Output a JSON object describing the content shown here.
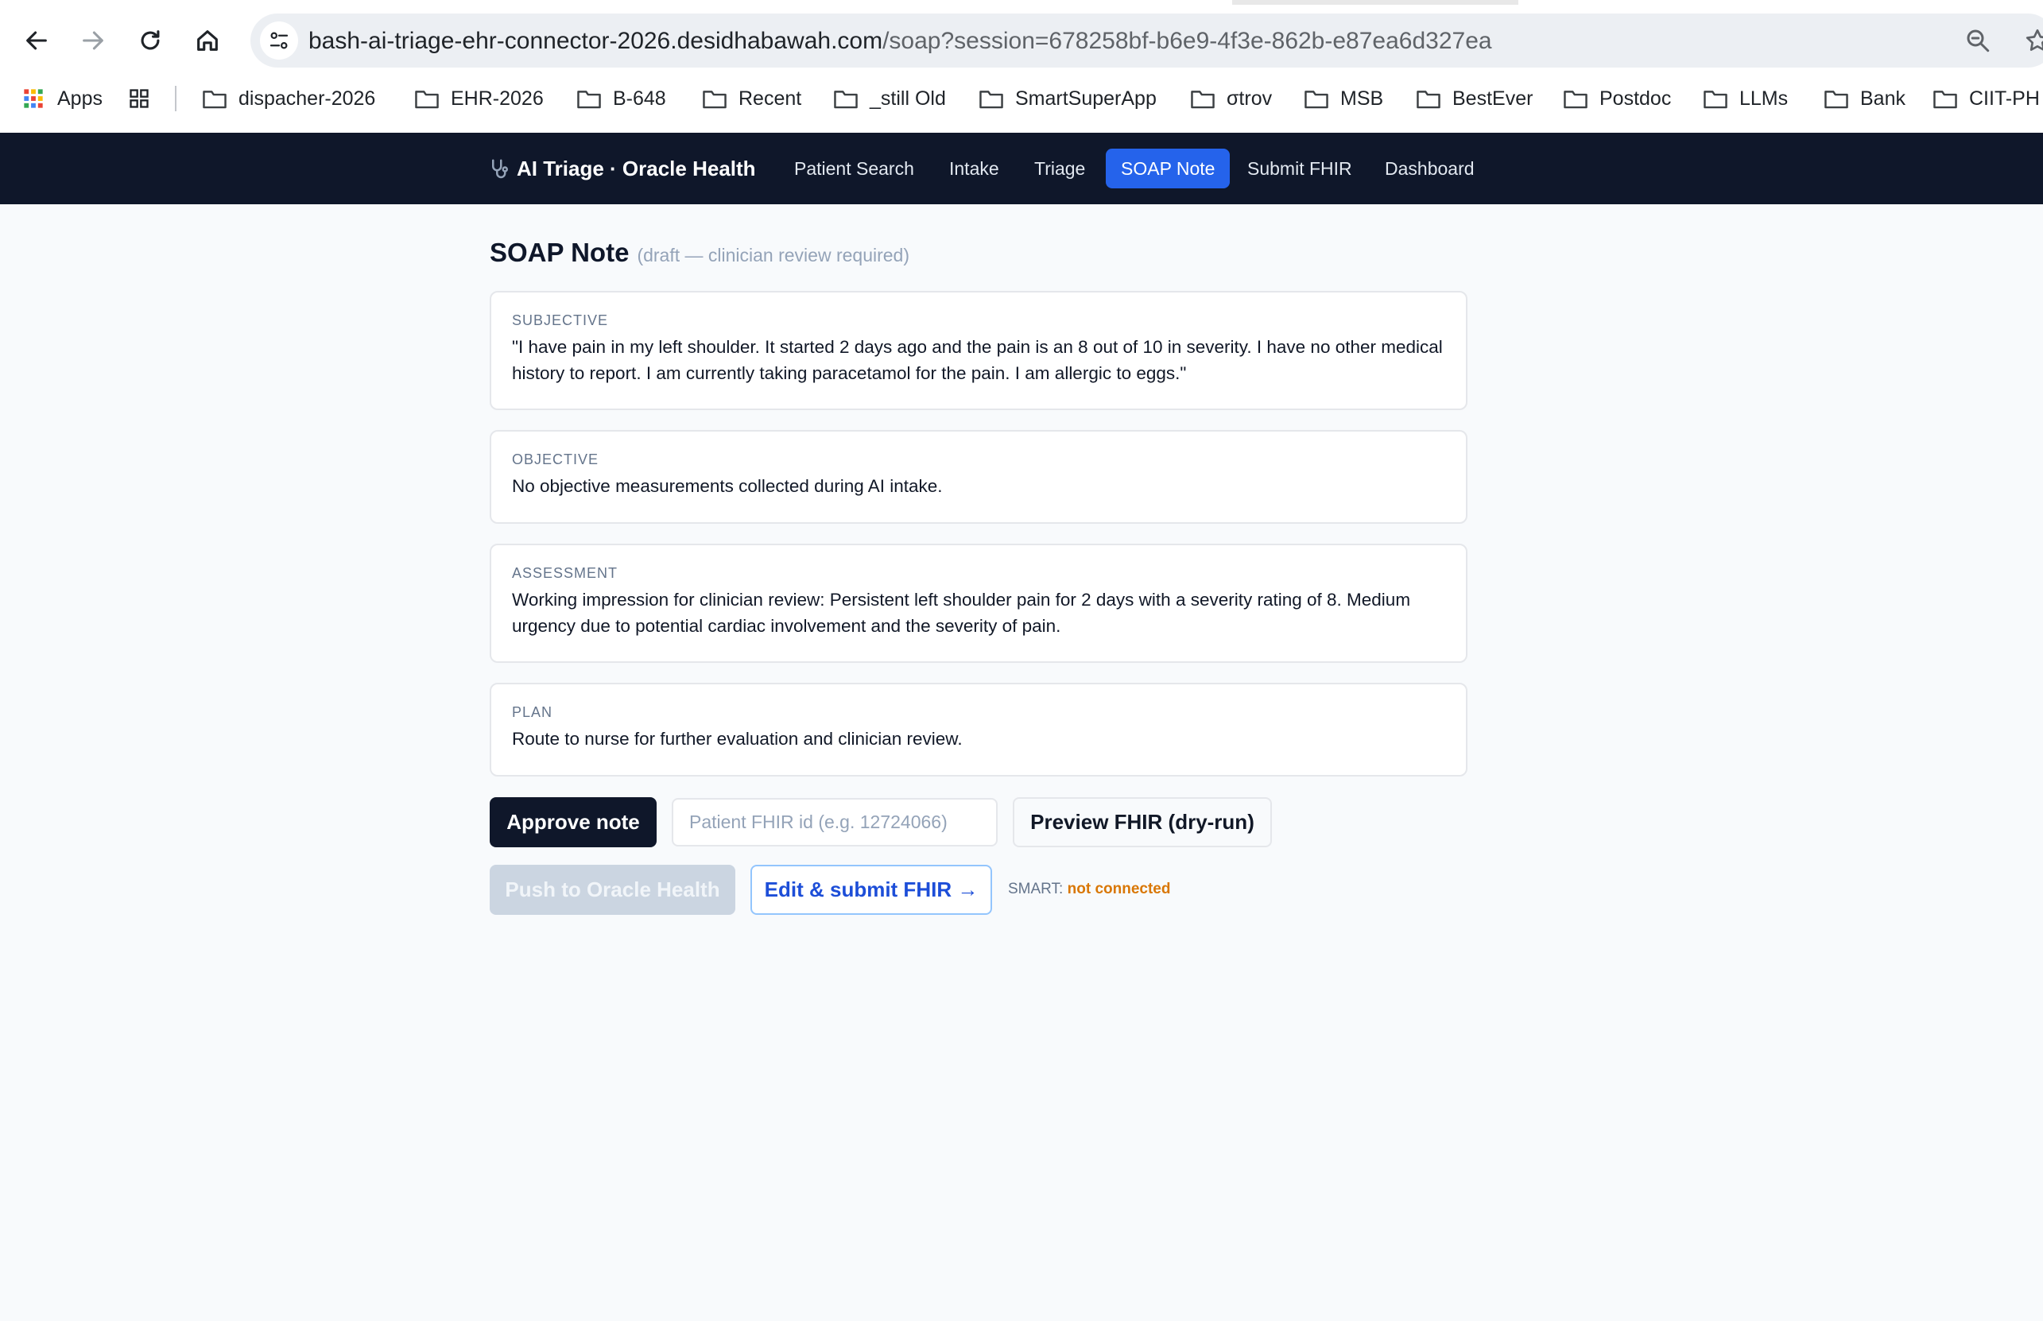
{
  "browser": {
    "url_host": "bash-ai-triage-ehr-connector-2026.desidhabawah.com",
    "url_path": "/soap?session=678258bf-b6e9-4f3e-862b-e87ea6d327ea",
    "bookmarks": [
      "Apps",
      "dispacher-2026",
      "EHR-2026",
      "B-648",
      "Recent",
      "_still Old",
      "SmartSuperApp",
      "σtrov",
      "MSB",
      "BestEver",
      "Postdoc",
      "LLMs",
      "Bank",
      "CIIT-PH"
    ]
  },
  "appnav": {
    "brand": "AI Triage · Oracle Health",
    "links": [
      "Patient Search",
      "Intake",
      "Triage",
      "SOAP Note",
      "Submit FHIR",
      "Dashboard"
    ],
    "active": "SOAP Note"
  },
  "page": {
    "title": "SOAP Note",
    "subtitle": "(draft — clinician review required)"
  },
  "soap": {
    "subjective": {
      "label": "Subjective",
      "text": "\"I have pain in my left shoulder. It started 2 days ago and the pain is an 8 out of 10 in severity. I have no other medical history to report. I am currently taking paracetamol for the pain. I am allergic to eggs.\""
    },
    "objective": {
      "label": "Objective",
      "text": "No objective measurements collected during AI intake."
    },
    "assessment": {
      "label": "Assessment",
      "text": "Working impression for clinician review: Persistent left shoulder pain for 2 days with a severity rating of 8. Medium urgency due to potential cardiac involvement and the severity of pain."
    },
    "plan": {
      "label": "Plan",
      "text": "Route to nurse for further evaluation and clinician review."
    }
  },
  "actions": {
    "approve": "Approve note",
    "fhir_id_placeholder": "Patient FHIR id (e.g. 12724066)",
    "fhir_id_value": "",
    "preview": "Preview FHIR (dry-run)",
    "push": "Push to Oracle Health",
    "edit_submit": "Edit & submit FHIR →",
    "smart_label": "SMART:",
    "smart_status": "not connected"
  },
  "colors": {
    "nav_bg": "#0f172a",
    "accent": "#2563eb",
    "status_warning": "#d97706"
  }
}
